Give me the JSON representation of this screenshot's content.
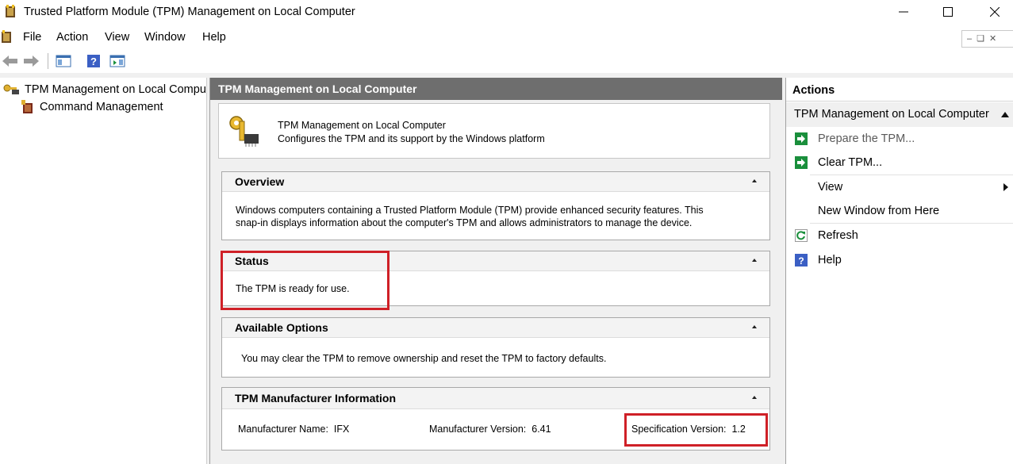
{
  "window": {
    "title": "Trusted Platform Module (TPM) Management on Local Computer"
  },
  "menu": {
    "items": [
      "File",
      "Action",
      "View",
      "Window",
      "Help"
    ]
  },
  "toolbar": {
    "buttons": [
      "back-arrow-icon",
      "forward-arrow-icon",
      "show-hide-console-tree-icon",
      "help-icon",
      "show-hide-action-pane-icon"
    ]
  },
  "tree": {
    "root": "TPM Management on Local Compu",
    "child": "Command Management"
  },
  "center": {
    "header": "TPM Management on Local Computer",
    "intro": {
      "title": "TPM Management on Local Computer",
      "description": "Configures the TPM and its support by the Windows platform"
    },
    "overview": {
      "heading": "Overview",
      "line1": "Windows computers containing a Trusted Platform Module (TPM) provide enhanced security features. This",
      "line2": "snap-in displays information about the computer's TPM and allows administrators to manage the device."
    },
    "status": {
      "heading": "Status",
      "text": "The TPM is ready for use."
    },
    "options": {
      "heading": "Available Options",
      "text": "You may clear the TPM to remove ownership and reset the TPM to factory defaults."
    },
    "manufacturer": {
      "heading": "TPM Manufacturer Information",
      "name_label": "Manufacturer Name:",
      "name_value": "IFX",
      "version_label": "Manufacturer Version:",
      "version_value": "6.41",
      "spec_label": "Specification Version:",
      "spec_value": "1.2"
    }
  },
  "actions": {
    "title": "Actions",
    "group": "TPM Management on Local Computer",
    "items": [
      {
        "label": "Prepare the TPM...",
        "icon": "green-arrow-icon"
      },
      {
        "label": "Clear TPM...",
        "icon": "green-arrow-icon"
      },
      {
        "label": "View",
        "icon": ""
      },
      {
        "label": "New Window from Here",
        "icon": ""
      },
      {
        "label": "Refresh",
        "icon": "refresh-icon"
      },
      {
        "label": "Help",
        "icon": "help-icon"
      }
    ]
  },
  "colors": {
    "highlight": "#cf2027",
    "center_header": "#6e6e6e",
    "action_icon_green": "#1a8f3c",
    "help_blue": "#3b5fc4"
  }
}
